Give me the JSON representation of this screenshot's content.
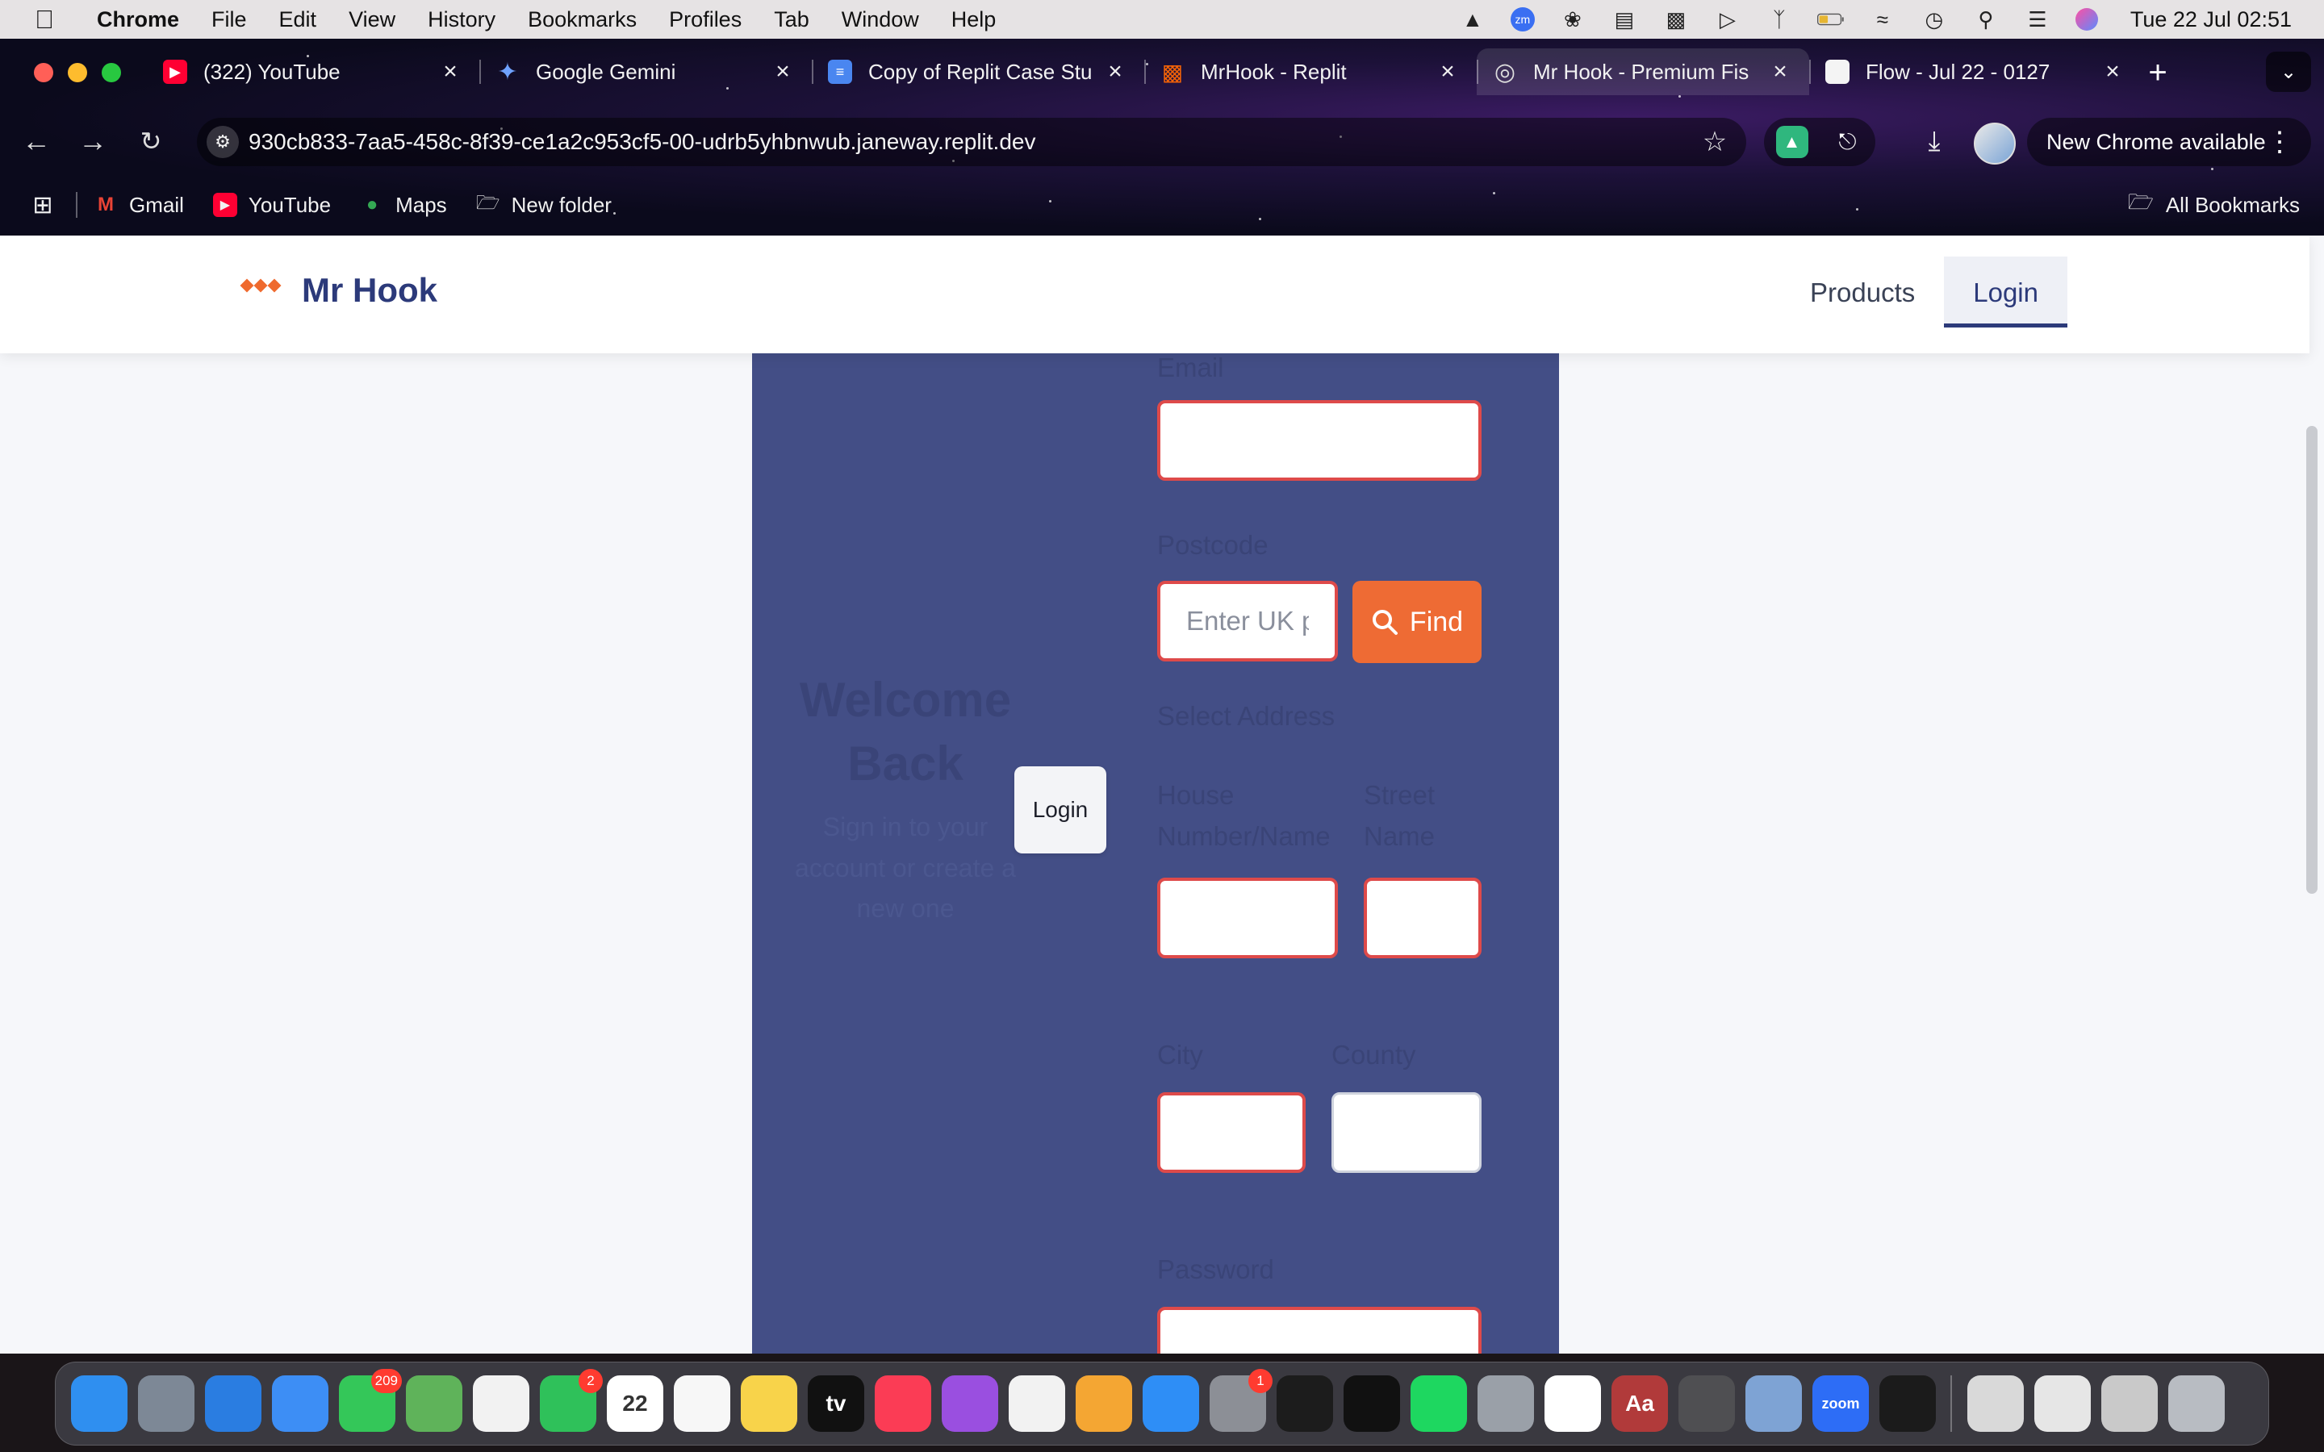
{
  "menubar": {
    "app_name": "Chrome",
    "items": [
      "File",
      "Edit",
      "View",
      "History",
      "Bookmarks",
      "Profiles",
      "Tab",
      "Window",
      "Help"
    ],
    "clock": "Tue 22 Jul  02:51"
  },
  "tabs": [
    {
      "title": "(322) YouTube",
      "icon": "youtube-icon"
    },
    {
      "title": "Google Gemini",
      "icon": "gemini-icon"
    },
    {
      "title": "Copy of Replit Case Stu",
      "icon": "docs-icon"
    },
    {
      "title": "MrHook - Replit",
      "icon": "replit-icon"
    },
    {
      "title": "Mr Hook - Premium Fis",
      "icon": "globe-icon",
      "active": true
    },
    {
      "title": "Flow - Jul 22 - 0127",
      "icon": "flow-icon"
    }
  ],
  "toolbar": {
    "url": "930cb833-7aa5-458c-8f39-ce1a2c953cf5-00-udrb5yhbnwub.janeway.replit.dev",
    "update_label": "New Chrome available"
  },
  "bookmarks": {
    "items": [
      "Gmail",
      "YouTube",
      "Maps",
      "New folder"
    ],
    "all_label": "All Bookmarks"
  },
  "site": {
    "brand": "Mr Hook",
    "nav": {
      "products": "Products",
      "login": "Login"
    },
    "accent": "#ee6b34",
    "brand_color": "#2c3a7a",
    "panel_color": "#434e86"
  },
  "auth": {
    "welcome_title": "Welcome Back",
    "welcome_sub": "Sign in to your account or create a new one",
    "login_button": "Login"
  },
  "form": {
    "email_label": "Email",
    "email_value": "",
    "postcode_label": "Postcode",
    "postcode_placeholder": "Enter UK postcode",
    "find_label": "Find",
    "select_address_label": "Select Address",
    "house_label": "House Number/Name",
    "street_label": "Street Name",
    "city_label": "City",
    "county_label": "County",
    "password_label": "Password"
  },
  "dock": {
    "apps": [
      {
        "name": "Finder",
        "icon": "finder-icon",
        "color": "#2f8ff0"
      },
      {
        "name": "Launchpad",
        "icon": "launchpad-icon",
        "color": "#7d8896"
      },
      {
        "name": "Safari",
        "icon": "safari-icon",
        "color": "#2a7de1"
      },
      {
        "name": "Mail",
        "icon": "mail-icon",
        "color": "#3d8ef5"
      },
      {
        "name": "Messages",
        "icon": "messages-icon",
        "color": "#34c759",
        "badge": "209"
      },
      {
        "name": "Maps",
        "icon": "maps-icon",
        "color": "#5fb35a"
      },
      {
        "name": "Photos",
        "icon": "photos-icon",
        "color": "#f2f2f2"
      },
      {
        "name": "FaceTime",
        "icon": "facetime-icon",
        "color": "#2fc15a",
        "badge": "2"
      },
      {
        "name": "Calendar",
        "icon": "calendar-icon",
        "color": "#ffffff",
        "text": "22"
      },
      {
        "name": "Reminders",
        "icon": "reminders-icon",
        "color": "#f7f7f7"
      },
      {
        "name": "Notes",
        "icon": "notes-icon",
        "color": "#f8d34a"
      },
      {
        "name": "TV",
        "icon": "tv-icon",
        "color": "#111111",
        "text": "tv"
      },
      {
        "name": "Music",
        "icon": "music-icon",
        "color": "#fb3c55"
      },
      {
        "name": "Podcasts",
        "icon": "podcasts-icon",
        "color": "#9a4fe0"
      },
      {
        "name": "News",
        "icon": "news-icon",
        "color": "#f2f2f2"
      },
      {
        "name": "Pages",
        "icon": "pages-icon",
        "color": "#f4a633"
      },
      {
        "name": "App Store",
        "icon": "app-store-icon",
        "color": "#2e8ef6"
      },
      {
        "name": "System Settings",
        "icon": "settings-icon",
        "color": "#8c8f96",
        "badge": "1"
      },
      {
        "name": "MuseScore",
        "icon": "musescore-icon",
        "color": "#1c1c1c"
      },
      {
        "name": "Shortcuts",
        "icon": "shortcut-icon",
        "color": "#111111"
      },
      {
        "name": "Spotify",
        "icon": "spotify-icon",
        "color": "#1ed760"
      },
      {
        "name": "iPhone Mirroring",
        "icon": "iphone-mirroring-icon",
        "color": "#9aa0a8"
      },
      {
        "name": "Chrome",
        "icon": "chrome-icon",
        "color": "#ffffff"
      },
      {
        "name": "Dictionary",
        "icon": "dictionary-icon",
        "color": "#b13a3a",
        "text": "Aa"
      },
      {
        "name": "Calculator",
        "icon": "calculator-icon",
        "color": "#4f4f52"
      },
      {
        "name": "Preview",
        "icon": "preview-icon",
        "color": "#7ea3d4"
      },
      {
        "name": "Zoom",
        "icon": "zoom-icon",
        "color": "#2d6df6",
        "text": "zoom"
      },
      {
        "name": "Cursor",
        "icon": "cursor-app-icon",
        "color": "#1b1b1b"
      }
    ],
    "stacks": [
      {
        "name": "Documents",
        "icon": "documents-stack-icon",
        "color": "#d9d9d9"
      },
      {
        "name": "Downloads",
        "icon": "downloads-stack-icon",
        "color": "#e6e6e6"
      },
      {
        "name": "Recents",
        "icon": "recents-stack-icon",
        "color": "#c9c9c9"
      },
      {
        "name": "Trash",
        "icon": "trash-icon",
        "color": "#b8bcc2"
      }
    ]
  }
}
